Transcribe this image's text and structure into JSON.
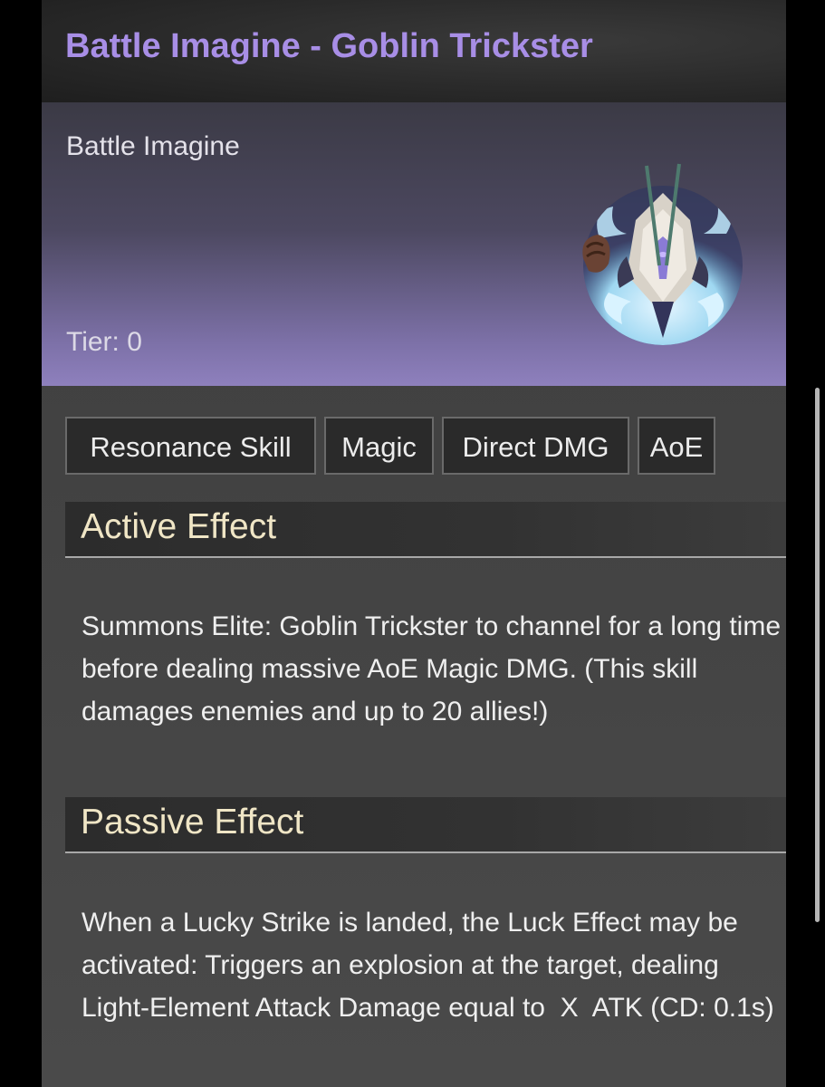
{
  "header": {
    "title": "Battle Imagine - Goblin Trickster"
  },
  "hero": {
    "type_label": "Battle Imagine",
    "tier_text": "Tier: 0",
    "portrait_icon": "goblin-trickster-portrait-icon"
  },
  "tags": [
    "Resonance Skill",
    "Magic",
    "Direct DMG",
    "AoE"
  ],
  "active_effect": {
    "title": "Active Effect",
    "description": "Summons Elite: Goblin Trickster to channel for a long time before dealing massive AoE Magic DMG. (This skill damages enemies and up to 20 allies!)"
  },
  "passive_effect": {
    "title": "Passive Effect",
    "description": "When a Lucky Strike is landed, the Luck Effect may be activated: Triggers an explosion at the target, dealing Light-Element Attack Damage equal to  X  ATK (CD: 0.1s)"
  },
  "colors": {
    "title_accent": "#a88ee6",
    "section_title": "#f0e6c6",
    "hero_gradient_end": "#8e80bd"
  }
}
